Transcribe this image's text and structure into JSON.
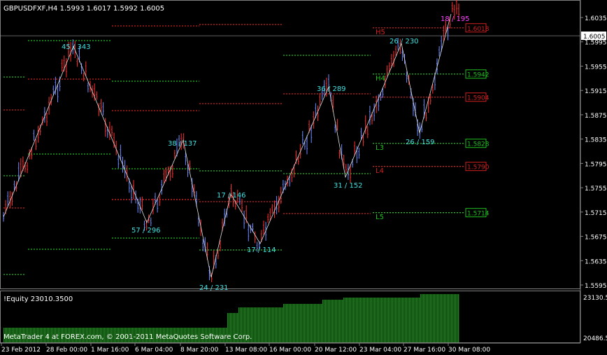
{
  "header": {
    "title": "GBPUSDFXF,H4  1.5993 1.6017 1.5992 1.6005"
  },
  "price_axis": {
    "ticks": [
      {
        "label": "1.6035",
        "v": 1.6035
      },
      {
        "label": "1.5995",
        "v": 1.5995
      },
      {
        "label": "1.5955",
        "v": 1.5955
      },
      {
        "label": "1.5915",
        "v": 1.5915
      },
      {
        "label": "1.5875",
        "v": 1.5875
      },
      {
        "label": "1.5835",
        "v": 1.5835
      },
      {
        "label": "1.5795",
        "v": 1.5795
      },
      {
        "label": "1.5755",
        "v": 1.5755
      },
      {
        "label": "1.5715",
        "v": 1.5715
      },
      {
        "label": "1.5675",
        "v": 1.5675
      },
      {
        "label": "1.5635",
        "v": 1.5635
      },
      {
        "label": "1.5595",
        "v": 1.5595
      }
    ],
    "current_price_label": "1.6005",
    "current_price": 1.6005
  },
  "time_axis": {
    "labels": [
      "23 Feb 2012",
      "28 Feb 00:00",
      "1 Mar 16:00",
      "6 Mar 04:00",
      "8 Mar 20:00",
      "13 Mar 08:00",
      "16 Mar 00:00",
      "20 Mar 12:00",
      "23 Mar 04:00",
      "27 Mar 16:00",
      "30 Mar 08:00"
    ]
  },
  "levels": [
    {
      "label": "1.6018",
      "v": 1.6018,
      "color": "#d02020",
      "box": true
    },
    {
      "label": "1.5942",
      "v": 1.5942,
      "color": "#20c020",
      "box": true
    },
    {
      "label": "1.5904",
      "v": 1.5904,
      "color": "#d02020",
      "box": true
    },
    {
      "label": "1.5828",
      "v": 1.5828,
      "color": "#20c020",
      "box": true
    },
    {
      "label": "1.5790",
      "v": 1.579,
      "color": "#d02020",
      "box": true
    },
    {
      "label": "1.5714",
      "v": 1.5714,
      "color": "#20c020",
      "box": true
    }
  ],
  "level_tags": [
    {
      "label": "H5",
      "color": "#d02020"
    },
    {
      "label": "H4",
      "color": "#20c020"
    },
    {
      "label": "L3",
      "color": "#20c020"
    },
    {
      "label": "L4",
      "color": "#d02020"
    },
    {
      "label": "L5",
      "color": "#20c020"
    }
  ],
  "zigzag_labels": [
    {
      "label": "45 / 343",
      "color": "#40e0e0"
    },
    {
      "label": "57 / 296",
      "color": "#40e0e0"
    },
    {
      "label": "38 / 137",
      "color": "#40e0e0"
    },
    {
      "label": "24 / 231",
      "color": "#40e0e0"
    },
    {
      "label": "17 / 146",
      "color": "#40e0e0"
    },
    {
      "label": "17 / 114",
      "color": "#40e0e0"
    },
    {
      "label": "36 / 289",
      "color": "#40e0e0"
    },
    {
      "label": "31 / 152",
      "color": "#40e0e0"
    },
    {
      "label": "26 / 230",
      "color": "#40e0e0"
    },
    {
      "label": "26 / 159",
      "color": "#40e0e0"
    },
    {
      "label": "18 / 195",
      "color": "#ff40ff"
    }
  ],
  "equity_panel": {
    "title": "!Equity 23010.3500",
    "axis_top": "23130.5",
    "axis_bottom": "20486.5",
    "bar_color": "#1e8a1e"
  },
  "footer": {
    "copyright": "MetaTrader 4 at FOREX.com, © 2001-2011 MetaQuotes Software Corp."
  },
  "colors": {
    "bull_candle": "#6e8cff",
    "bear_candle": "#ff3030",
    "zigzag": "#e0e0e0",
    "grid_text": "#ffffff"
  }
}
